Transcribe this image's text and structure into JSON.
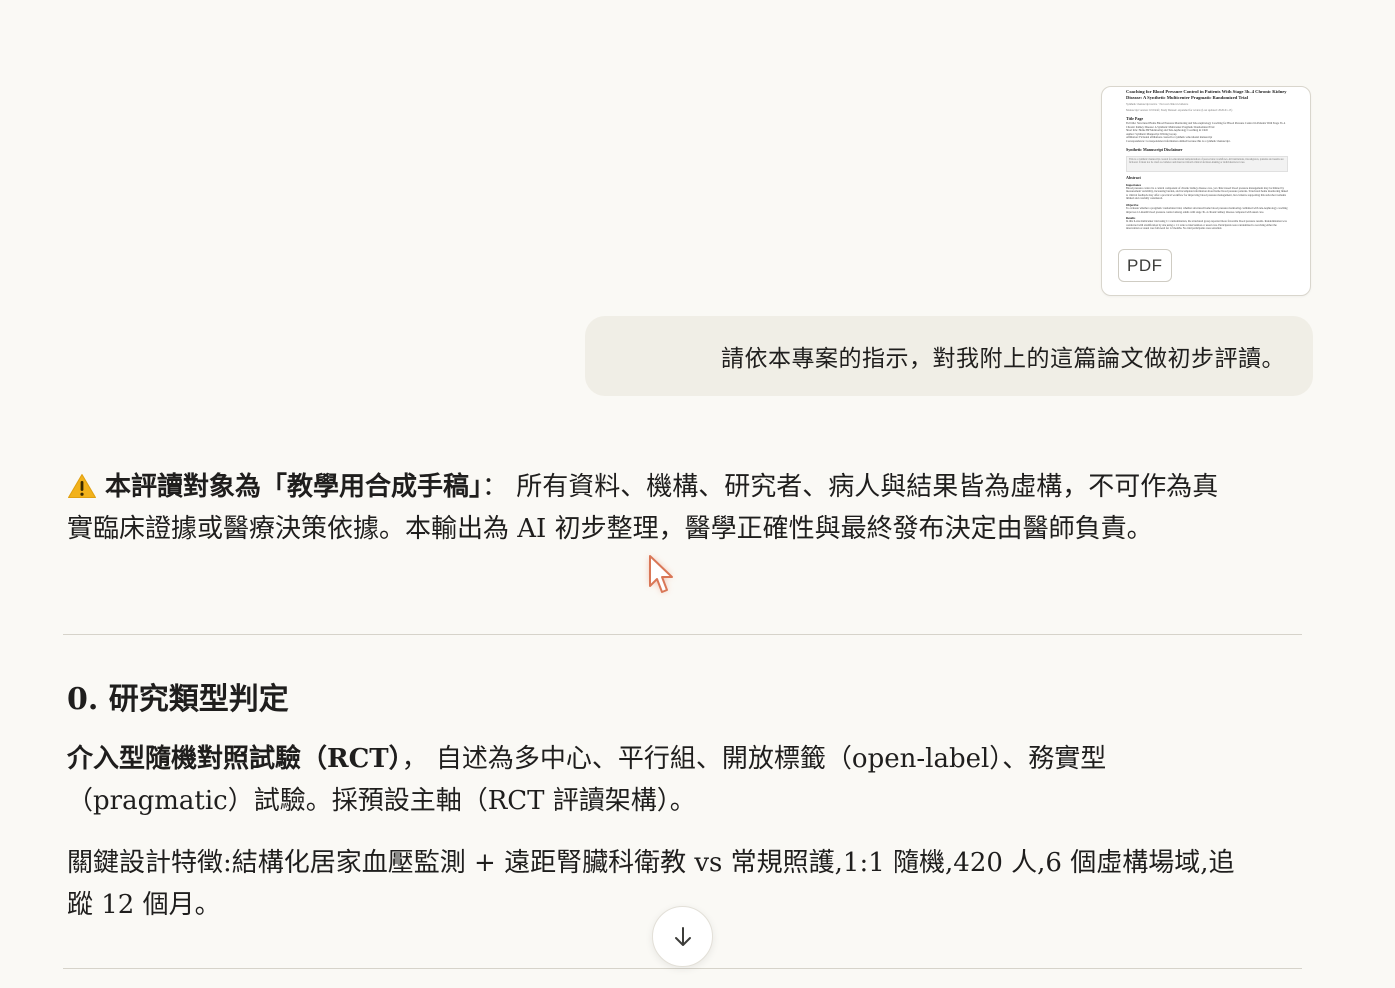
{
  "attachment": {
    "badge": "PDF",
    "thumbnail": {
      "title": "Coaching for Blood Pressure Control in Patients With Stage 3b–4 Chronic Kidney Disease: A Synthetic Multicenter Pragmatic Randomized Trial",
      "meta1": "Synthetic manuscript notice · Not real clinical evidence",
      "meta2": "Manuscript version: 0.9 Draft; Study Dataset: expanded for review (Last updated: 2026-01-15)",
      "h_title_page": "Title Page",
      "full_title": "Full title: Structured Home Blood Pressure Monitoring and Tele-nephrology Coaching for Blood Pressure Control in Patients With Stage 3b–4 Chronic Kidney Disease: A Synthetic Multicenter Pragmatic Randomized Trial",
      "short_title": "Short title: Home BP Monitoring and Tele-nephrology Coaching in CKD",
      "author": "Author: Synthetic Manuscript Writing Group",
      "affiliation": "Affiliation: Fictional affiliations created for synthetic educational manuscript",
      "correspondence": "Correspondence: Correspondence information omitted because this is a synthetic manuscript.",
      "h_disclaimer": "Synthetic Manuscript Disclaimer",
      "disclaimer": "This is a synthetic manuscript created for educational demonstration of peer-review workflows. All institutions, investigators, patients and results are fictional. It must not be cited as evidence and must not inform clinical decision-making or individual-level care.",
      "h_abstract": "Abstract",
      "h_importance": "Importance",
      "importance": "Blood pressure control is a central component of chronic kidney disease care, yet clinic-based blood pressure management may be limited by measurement variability, increasing burden, and incomplete information about home blood pressure patterns. Structured home monitoring linked to clinical feedback may offer a practical workflow for improving blood pressure management, but evidence supporting this subcohort remains limited and carefully considered.",
      "h_objective": "Objective",
      "objective": "To evaluate whether a pragmatic randomized trial, whether structured home blood pressure monitoring combined with tele-nephrology coaching improves 12-month blood pressure control among adults with stage 3b–4 chronic kidney disease compared with usual care.",
      "h_results": "Results",
      "results": "In this 6-site multicenter trial using 1:1 randomization, the structured group reported more favorable blood pressure results. Randomization was conducted with stratification by site using a 1:1 ratio to intervention or usual care. Participants were randomized to receiving either the intervention or usual care followed for 12 months. No trial participants were enrolled."
    }
  },
  "user_message": "請依本專案的指示，對我附上的這篇論文做初步評讀。",
  "response": {
    "warning_bold": "本評讀對象為「教學用合成手稿」",
    "warning_rest": "： 所有資料、機構、研究者、病人與結果皆為虛構，不可作為真實臨床證據或醫療決策依據。本輸出為 AI 初步整理，醫學正確性與最終發布決定由醫師負責。",
    "section0_title": "0. 研究類型判定",
    "section0_bold": "介入型隨機對照試驗（RCT）",
    "section0_rest": "， 自述為多中心、平行組、開放標籤（open-label）、務實型（pragmatic）試驗。採預設主軸（RCT 評讀架構）。",
    "section0_design": "關鍵設計特徵:結構化居家血壓監測 + 遠距腎臟科衛教 vs 常規照護,1:1 隨機,420 人,6 個虛構場域,追蹤 12 個月。"
  },
  "icons": {
    "warning": "warning-icon",
    "scroll": "arrow-down-icon",
    "cursor": "mouse-cursor-icon"
  },
  "colors": {
    "background": "#faf9f5",
    "bubble": "#f0eee6",
    "warning_yellow": "#f2b21b",
    "cursor_accent": "#d97757"
  }
}
